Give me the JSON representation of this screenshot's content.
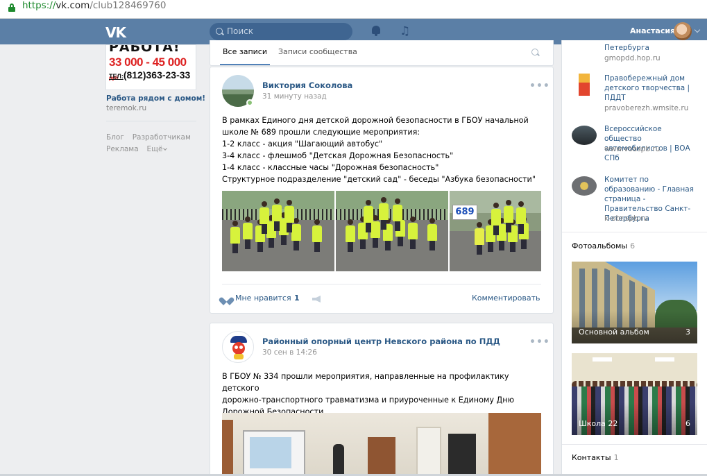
{
  "browser": {
    "url_proto": "https://",
    "url_host": "vk.com",
    "url_path": "/club128469760"
  },
  "header": {
    "logo": "VK",
    "search_placeholder": "Поиск",
    "username": "Анастасия"
  },
  "left": {
    "ad": {
      "top_text": "РАБОТА!",
      "salary": "33 000 - 45 000",
      "salary_unit": "руб.",
      "tel_label": "ТЕЛ:",
      "phone": "(812)363-23-33",
      "title": "Работа рядом с домом!",
      "domain": "teremok.ru"
    },
    "links": [
      "Блог",
      "Разработчикам",
      "Реклама",
      "Ещё"
    ]
  },
  "tabs": {
    "all": "Все записи",
    "community": "Записи сообщества"
  },
  "posts": [
    {
      "author": "Виктория Соколова",
      "time": "31 минуту назад",
      "more": "•••",
      "text": "В рамках Единого дня детской дорожной безопасности в ГБОУ начальной\nшколе № 689 прошли следующие мероприятия:\n1-2 класс - акция \"Шагающий автобус\"\n3-4 класс - флешмоб \"Детская Дорожная Безопасность\"\n1-4 класс - классные часы \"Дорожная безопасность\"\nСтруктурное подразделение \"детский сад\" - беседы \"Азбука безопасности\"",
      "sign": "689",
      "like_label": "Мне нравится",
      "like_count": "1",
      "comment_label": "Комментировать"
    },
    {
      "author": "Районный опорный центр Невского района по ПДД",
      "time": "30 сен в 14:26",
      "more": "•••",
      "text": "В ГБОУ № 334 прошли мероприятия, направленные на профилактику детского\nдорожно-транспортного травматизма и приуроченные к Единому Дню\nДорожной Безопасности."
    }
  ],
  "right": {
    "links": [
      {
        "title": "Петербурга",
        "domain": "gmopdd.hop.ru"
      },
      {
        "title": "Правобережный дом детского творчества | ПДДТ",
        "domain": "pravoberezh.wmsite.ru"
      },
      {
        "title": "Всероссийское общество автомобилистов | ВОА СПб",
        "domain": "www.voaspb.ru"
      },
      {
        "title": "Комитет по образованию - Главная страница - Правительство Санкт-Петербурга",
        "domain": "k-obr.spb.ru"
      }
    ],
    "albums_title": "Фотоальбомы",
    "albums_count": "6",
    "albums": [
      {
        "name": "Основной альбом",
        "count": "3"
      },
      {
        "name": "Школа 22",
        "count": "6"
      }
    ],
    "contacts_title": "Контакты",
    "contacts_count": "1"
  }
}
